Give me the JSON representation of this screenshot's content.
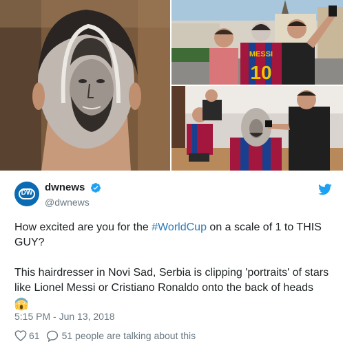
{
  "account": {
    "display_name": "dwnews",
    "handle": "@dwnews",
    "avatar_text": "DW",
    "brand_color": "#0a6bb3",
    "verified": true
  },
  "tweet": {
    "text_before_hashtag": "How excited are you for the ",
    "hashtag": "#WorldCup",
    "text_after_hashtag": " on a scale of 1 to THIS GUY?",
    "paragraph_2": "This hairdresser in Novi Sad, Serbia is clipping 'portraits' of stars like Lionel Messi or Cristiano Ronaldo onto the back of heads",
    "emoji": "screaming-face"
  },
  "meta": {
    "timestamp": "5:15 PM - Jun 13, 2018",
    "likes": "61",
    "conversation": "51 people are talking about this"
  },
  "photos": {
    "jersey_name": "MESSI",
    "jersey_number": "10"
  },
  "colors": {
    "link": "#2b7bb9",
    "muted": "#697882",
    "twitter_blue": "#1da1f2"
  },
  "icons": [
    "twitter-bird-icon",
    "verified-badge-icon",
    "heart-icon",
    "reply-bubble-icon",
    "screaming-face-emoji"
  ]
}
